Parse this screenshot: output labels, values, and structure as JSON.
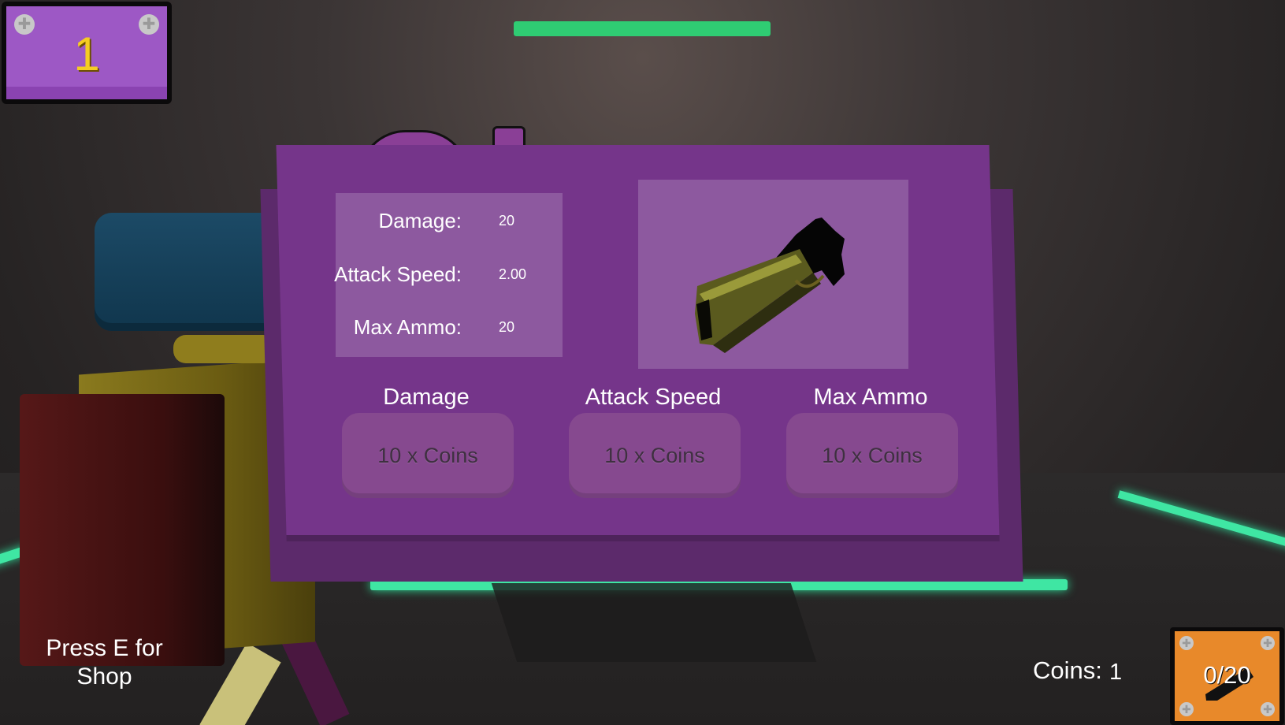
{
  "hud": {
    "level": "1",
    "health_fraction": 1.0,
    "prompt": "Press E for Shop",
    "coins_label": "Coins:",
    "coins_value": "1",
    "ammo": "0/20"
  },
  "shop": {
    "stats": [
      {
        "label": "Damage:",
        "value": "20"
      },
      {
        "label": "Attack Speed:",
        "value": "2.00"
      },
      {
        "label": "Max Ammo:",
        "value": "20"
      }
    ],
    "upgrades": [
      {
        "title": "Damage",
        "cost": "10 x Coins"
      },
      {
        "title": "Attack Speed",
        "cost": "10 x Coins"
      },
      {
        "title": "Max Ammo",
        "cost": "10 x Coins"
      }
    ],
    "weapon_icon": "pistol-icon"
  },
  "colors": {
    "panel": "#75358a",
    "health": "#2fcc73",
    "level_text": "#f5cc22",
    "ammo_card": "#e8892a",
    "neon": "#3fe6a3"
  }
}
